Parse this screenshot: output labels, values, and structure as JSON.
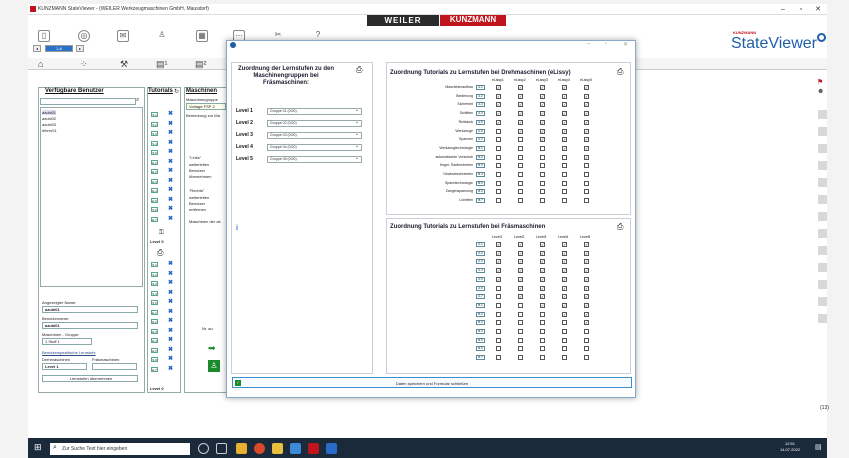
{
  "window": {
    "title": "KUNZMANN StateViewer - (WEILER Werkzeugmaschinen GmbH, Mausdorf)"
  },
  "brand": {
    "weiler": "WEILER",
    "kunzmann": "KUNZMANN",
    "kunzmann_sub": "FRÄSMASCHINEN",
    "sv_small": "KUNZMANN",
    "sv_title": "StateViewer"
  },
  "toolbar": {
    "nav_value": "1-6"
  },
  "left_panel": {
    "title": "Verfügbare Benutzer",
    "users": [
      "azubi01",
      "azubi02",
      "azubi03",
      "lehrer01"
    ],
    "selected_label": "Angezeigter Name:",
    "selected_value": "azubi01",
    "username_label": "Benutzername:",
    "username_value": "azubi01",
    "group_label": "Maschinen - Gruppe:",
    "group_value": "1 Stuff 1",
    "settings_link": "Benutzerspezifische Lernstufe",
    "turning_label": "Drehmaschinen",
    "milling_label": "Fräsmaschinen",
    "level_value": "Level 1",
    "assign_button": "Lernstufen übernehmen"
  },
  "tutorials_panel": {
    "title": "Tutorials",
    "codes_top": [
      "S.1",
      "S.2",
      "S.3",
      "S.4",
      "S.5",
      "E.1",
      "E.2",
      "E.3",
      "E.4",
      "E.5",
      "S.6",
      "E.7"
    ],
    "level_label_1": "Level 0",
    "codes_bottom": [
      "S.1",
      "S.2",
      "S.3",
      "S.4",
      "S.5",
      "E.1",
      "E.2",
      "E.3",
      "E.4",
      "E.5",
      "S.6",
      "E.7"
    ],
    "level_label_2": "Level 0"
  },
  "machine_panel": {
    "title": "Maschinen",
    "lbl_group": "Maschinengruppe",
    "group_value": "Vorlage FSP 2",
    "lbl_desc": "Bemerkung zur Ma",
    "links_label": "\"Links\"",
    "links_a": "weiterleiten",
    "links_b": "Benutzer",
    "links_c": "übernehmen",
    "rechts_label": "\"Rechts\"",
    "rechts_a": "weiterleiten",
    "rechts_b": "Benutzer",
    "rechts_c": "entfernen",
    "machines_label": "Maschinen der ak",
    "hint": "Nr. au"
  },
  "dialog": {
    "left_header": "Zuordnung der Lernstufen zu den Maschinengruppen bei Fräsmaschinen:",
    "levels": [
      {
        "label": "Level 1",
        "value": "Gruppe 01 (0/20)"
      },
      {
        "label": "Level 2",
        "value": "Gruppe 02 (0/20)"
      },
      {
        "label": "Level 3",
        "value": "Gruppe 03 (0/20)"
      },
      {
        "label": "Level 4",
        "value": "Gruppe 04 (0/20)"
      },
      {
        "label": "Level 5",
        "value": "Gruppe 05 (0/20)"
      }
    ],
    "turning_header": "Zuordnung Tutorials zu Lernstufen bei Drehmaschinen (eLissy)",
    "turning_cols": [
      "eLissy1",
      "eLissy2",
      "eLissy3",
      "eLissy4",
      "eLissy5"
    ],
    "turning_rows": [
      {
        "label": "Maschinenaufbau",
        "code": "A.1",
        "checks": [
          1,
          1,
          1,
          1,
          1
        ]
      },
      {
        "label": "Bedienung",
        "code": "A.2",
        "checks": [
          1,
          1,
          1,
          1,
          1
        ]
      },
      {
        "label": "Sicherheit",
        "code": "A.3",
        "checks": [
          1,
          1,
          1,
          1,
          1
        ]
      },
      {
        "label": "Schlitten",
        "code": "A.4",
        "checks": [
          1,
          1,
          1,
          1,
          1
        ]
      },
      {
        "label": "Reitstock",
        "code": "A.5",
        "checks": [
          1,
          1,
          1,
          1,
          1
        ]
      },
      {
        "label": "Werkzeuge",
        "code": "A.6",
        "checks": [
          0,
          1,
          1,
          1,
          1
        ]
      },
      {
        "label": "Spannen",
        "code": "A.7",
        "checks": [
          0,
          0,
          1,
          1,
          1
        ]
      },
      {
        "label": "Werkzeugtechnologie",
        "code": "B.1",
        "checks": [
          0,
          0,
          0,
          1,
          1
        ]
      },
      {
        "label": "automatischer Vorschub",
        "code": "B.2",
        "checks": [
          0,
          0,
          0,
          0,
          1
        ]
      },
      {
        "label": "Kegel- Radiendrehen",
        "code": "B.3",
        "checks": [
          0,
          0,
          0,
          0,
          0
        ]
      },
      {
        "label": "Gewindeschneiden",
        "code": "B.4",
        "checks": [
          0,
          0,
          0,
          0,
          0
        ]
      },
      {
        "label": "Spanntechnologie",
        "code": "B.5",
        "checks": [
          0,
          0,
          0,
          0,
          0
        ]
      },
      {
        "label": "Zangenspannung",
        "code": "B.6",
        "checks": [
          0,
          0,
          0,
          0,
          0
        ]
      },
      {
        "label": "Lünetten",
        "code": "B.7",
        "checks": [
          0,
          0,
          0,
          0,
          0
        ]
      }
    ],
    "milling_header": "Zuordnung Tutorials zu Lernstufen bei Fräsmaschinen",
    "milling_cols": [
      "Level1",
      "Level2",
      "Level3",
      "Level4",
      "Level5"
    ],
    "milling_rows": [
      {
        "code": "A.1",
        "checks": [
          1,
          1,
          1,
          1,
          1
        ]
      },
      {
        "code": "A.2",
        "checks": [
          1,
          1,
          1,
          1,
          1
        ]
      },
      {
        "code": "A.3",
        "checks": [
          1,
          1,
          1,
          1,
          1
        ]
      },
      {
        "code": "A.4",
        "checks": [
          1,
          1,
          1,
          1,
          1
        ]
      },
      {
        "code": "A.5",
        "checks": [
          1,
          1,
          1,
          1,
          1
        ]
      },
      {
        "code": "A.6",
        "checks": [
          0,
          1,
          1,
          1,
          1
        ]
      },
      {
        "code": "A.7",
        "checks": [
          0,
          1,
          1,
          1,
          1
        ]
      },
      {
        "code": "B.1",
        "checks": [
          0,
          0,
          1,
          1,
          1
        ]
      },
      {
        "code": "B.2",
        "checks": [
          0,
          0,
          0,
          1,
          1
        ]
      },
      {
        "code": "B.3",
        "checks": [
          0,
          0,
          0,
          0,
          1
        ]
      },
      {
        "code": "B.4",
        "checks": [
          0,
          0,
          0,
          0,
          0
        ]
      },
      {
        "code": "B.5",
        "checks": [
          0,
          0,
          0,
          0,
          0
        ]
      },
      {
        "code": "B.6",
        "checks": [
          0,
          0,
          0,
          0,
          0
        ]
      },
      {
        "code": "B.7",
        "checks": [
          0,
          0,
          0,
          0,
          0
        ]
      }
    ],
    "save_label": "Daten speichern und Formular schließen"
  },
  "taskbar": {
    "search_placeholder": "Zur Suche Text hier eingeben",
    "time": "12:51",
    "date": "14.07.2022"
  },
  "right_marker": "(13)"
}
